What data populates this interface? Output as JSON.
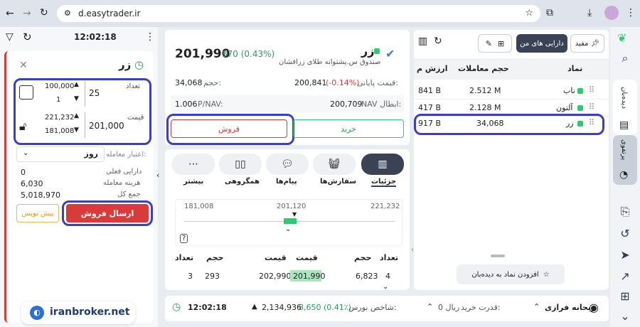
{
  "browser": {
    "url": "d.easytrader.ir"
  },
  "order": {
    "time": "12:02:18",
    "symbol": "زر",
    "qty_label": "تعداد",
    "qty_value": "25",
    "qty_max": "100,000",
    "qty_min": "1",
    "price_label": "قیمت",
    "price_value": "201,000",
    "price_max": "221,232",
    "price_min": "181,008",
    "credit_label": "اعتبار معامله:",
    "credit_value": "روز",
    "current_asset_label": "دارایی فعلی",
    "current_asset": "0",
    "fee_label": "هزینه معامله",
    "fee": "6,030",
    "total_label": "جمع کل",
    "total": "5,018,970",
    "send_sell": "ارسال فروش",
    "draft": "پیش نویس",
    "brand": "iranbroker.net"
  },
  "detail": {
    "symbol": "زر",
    "subtitle": "صندوق س.پشتوانه طلای زرافشان",
    "price": "201,990",
    "change": "870 (0.43%)",
    "last_price_label": "قیمت پایانی:",
    "last_price": "200,841",
    "last_change": "(-0.14%)",
    "volume_label": "حجم:",
    "volume": "34,068",
    "nav_label": "NAV ابطال:",
    "nav": "200,709",
    "pnav_label": "P/NAV:",
    "pnav": "1.006",
    "buy": "خرید",
    "sell": "فروش",
    "tabs": [
      "جزئیات",
      "سفارش‌ها",
      "پیام‌ها",
      "همگروهی",
      "بیشتر"
    ],
    "range": [
      "181,008",
      "201,120",
      "221,232"
    ],
    "book_headers": [
      "تعداد",
      "حجم",
      "قیمت",
      "قیمت",
      "حجم",
      "تعداد"
    ],
    "book_row": [
      "4",
      "6,823",
      "201,990",
      "202,990",
      "293",
      "3"
    ]
  },
  "watch": {
    "tab_active": "دارایی های من",
    "tab_other": "مفید",
    "headers": [
      "نماد",
      "حجم معاملات",
      "ارزش م"
    ],
    "rows": [
      {
        "name": "ناب",
        "vol": "2.512 M",
        "val": "841 B"
      },
      {
        "name": "آلتون",
        "vol": "2.128 M",
        "val": "417 B"
      },
      {
        "name": "زر",
        "vol": "34,068",
        "val": "917 B"
      }
    ],
    "add": "افزودن نماد به دیده‌بان"
  },
  "footer": {
    "time": "12:02:18",
    "index_label": "شاخص بورس:",
    "index": "2,134,936",
    "index_change": "8,650 (0.41٪)",
    "power_label": "قدرت خرید:",
    "power": "0 ریال",
    "user": "ریحانه فرازی"
  },
  "rail": {
    "watch": "دیده‌بان",
    "portfolio": "پرتفوی"
  },
  "colors": {
    "green": "#2ecc71",
    "red": "#d93b3b",
    "accent": "#3b3fc8"
  }
}
